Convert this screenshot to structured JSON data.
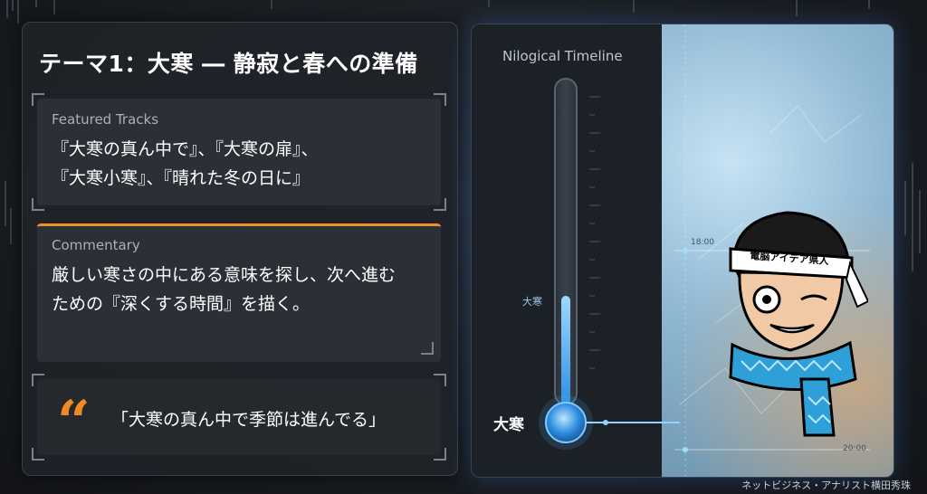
{
  "title": "テーマ1：大寒 ― 静寂と春への準備",
  "tracks": {
    "label": "Featured Tracks",
    "line1": "『大寒の真ん中で』、『大寒の扉』、",
    "line2": "『大寒小寒』、『晴れた冬の日に』"
  },
  "commentary": {
    "label": "Commentary",
    "line1": "厳しい寒さの中にある意味を探し、次へ進む",
    "line2": "ための『深くする時間』を描く。"
  },
  "quote": {
    "mark": "“",
    "text": "「大寒の真ん中で季節は進んでる」"
  },
  "timeline": {
    "title": "Nilogical Timeline",
    "marker_small": "大寒",
    "marker_big": "大寒",
    "frost_ticks": [
      "18:00",
      "20:00"
    ]
  },
  "character": {
    "headband_text": "電脳アイデア県人"
  },
  "author": "ネットビジネス・アナリスト横田秀珠",
  "colors": {
    "accent_orange": "#f08a24",
    "thermo_blue": "#4fb4ff"
  }
}
